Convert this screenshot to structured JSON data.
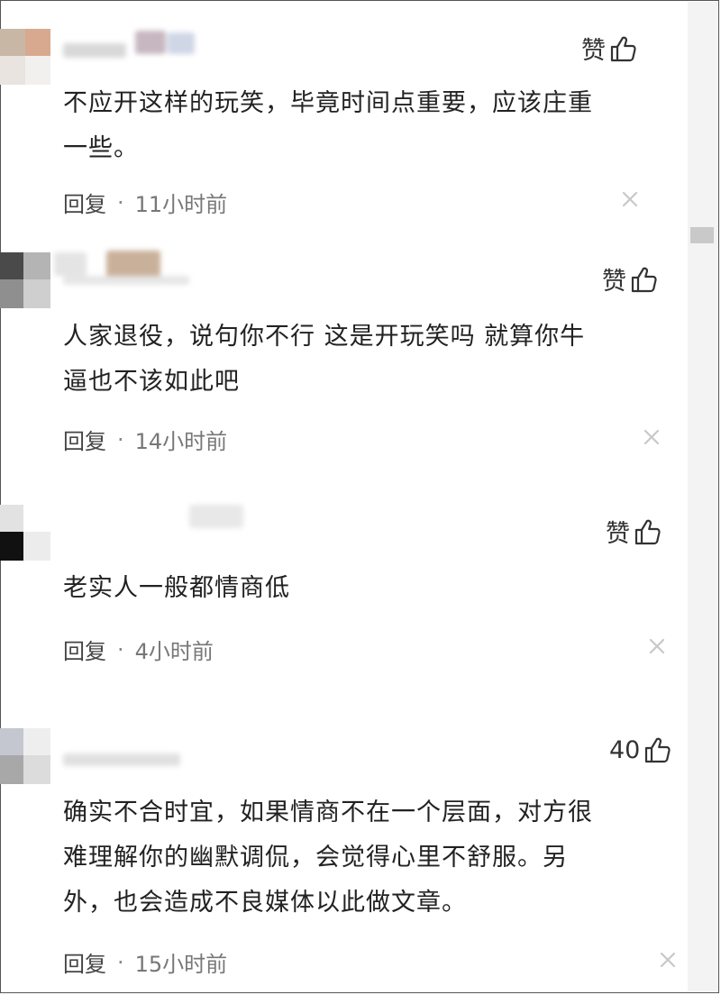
{
  "comments": [
    {
      "like_label": "赞",
      "content_lines": [
        "不应开这样的玩笑，毕竟时间点重要，应该庄重",
        "一些。"
      ],
      "reply_label": "回复",
      "separator": "·",
      "time": "11小时前"
    },
    {
      "like_label": "赞",
      "content_lines": [
        "人家退役，说句你不行 这是开玩笑吗 就算你牛",
        "逼也不该如此吧"
      ],
      "reply_label": "回复",
      "separator": "·",
      "time": "14小时前"
    },
    {
      "like_label": "赞",
      "content_lines": [
        "老实人一般都情商低"
      ],
      "reply_label": "回复",
      "separator": "·",
      "time": "4小时前"
    },
    {
      "like_label": "40",
      "content_lines": [
        "确实不合时宜，如果情商不在一个层面，对方很",
        "难理解你的幽默调侃，会觉得心里不舒服。另",
        "外，也会造成不良媒体以此做文章。"
      ],
      "reply_label": "回复",
      "separator": "·",
      "time": "15小时前"
    }
  ],
  "icons": {
    "like": "thumbs-up-icon",
    "close": "close-icon"
  },
  "colors": {
    "text": "#222222",
    "meta": "#777777",
    "close": "#c8c8c8"
  }
}
